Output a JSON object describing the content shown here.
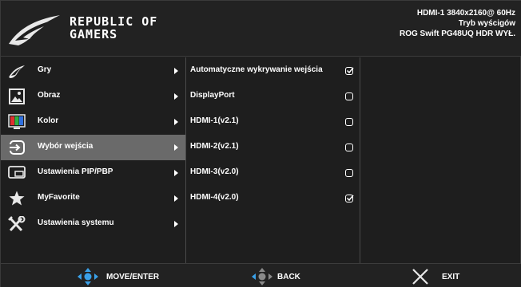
{
  "header": {
    "brand_line1": "REPUBLIC OF",
    "brand_line2": "GAMERS",
    "status_line1": "HDMI-1  3840x2160@ 60Hz",
    "status_line2": "Tryb wyścigów",
    "status_line3": "ROG Swift  PG48UQ  HDR WYŁ."
  },
  "menu": {
    "items": [
      {
        "label": "Gry",
        "icon": "rog-eye-icon"
      },
      {
        "label": "Obraz",
        "icon": "image-icon"
      },
      {
        "label": "Kolor",
        "icon": "color-icon"
      },
      {
        "label": "Wybór wejścia",
        "icon": "input-icon",
        "selected": true
      },
      {
        "label": "Ustawienia PIP/PBP",
        "icon": "pip-icon"
      },
      {
        "label": "MyFavorite",
        "icon": "star-icon"
      },
      {
        "label": "Ustawienia systemu",
        "icon": "wrench-icon"
      }
    ]
  },
  "submenu": {
    "items": [
      {
        "label": "Automatyczne wykrywanie wejścia",
        "checked": true
      },
      {
        "label": "DisplayPort",
        "checked": false
      },
      {
        "label": "HDMI-1(v2.1)",
        "checked": false
      },
      {
        "label": "HDMI-2(v2.1)",
        "checked": false
      },
      {
        "label": "HDMI-3(v2.0)",
        "checked": false
      },
      {
        "label": "HDMI-4(v2.0)",
        "checked": true
      }
    ]
  },
  "footer": {
    "move_enter": "MOVE/ENTER",
    "back": "BACK",
    "exit": "EXIT"
  },
  "colors": {
    "background": "#1e1e1e",
    "selected": "#6a6a6a",
    "accent_blue": "#3aa0e8"
  }
}
